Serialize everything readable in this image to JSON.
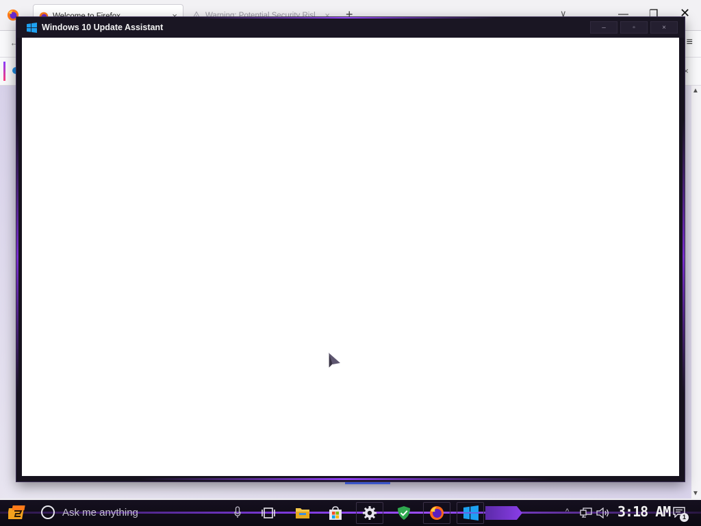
{
  "browser": {
    "tabs": [
      {
        "label": "Welcome to Firefox",
        "active": true
      },
      {
        "label": "Warning: Potential Security Risk Ah",
        "active": false
      }
    ],
    "new_tab_label": "+",
    "tab_close_glyph": "×",
    "list_all_tabs_glyph": "∨",
    "window_controls": {
      "minimize": "—",
      "maximize": "❐",
      "close": "✕"
    },
    "back_glyph": "←",
    "menu_glyph": "≡",
    "notification_close_glyph": "×",
    "scroll_up_glyph": "▲",
    "scroll_down_glyph": "▼"
  },
  "dialog": {
    "title": "Windows 10 Update Assistant",
    "controls": {
      "minimize": "–",
      "maximize": "▫",
      "close": "×"
    },
    "accent_color": "#8a3ef0"
  },
  "taskbar": {
    "search_placeholder": "Ask me anything",
    "clock": "3:18 AM",
    "overflow_glyph": "^",
    "notification_count": "1",
    "pinned": [
      {
        "name": "task-view",
        "icon": "task-view-icon"
      },
      {
        "name": "file-explorer",
        "icon": "folder-icon"
      },
      {
        "name": "microsoft-store",
        "icon": "store-bag-icon"
      },
      {
        "name": "settings",
        "icon": "gear-icon"
      },
      {
        "name": "windows-security",
        "icon": "shield-check-icon"
      },
      {
        "name": "firefox",
        "icon": "firefox-icon"
      },
      {
        "name": "windows-update-assistant",
        "icon": "windows-logo-icon"
      }
    ]
  }
}
